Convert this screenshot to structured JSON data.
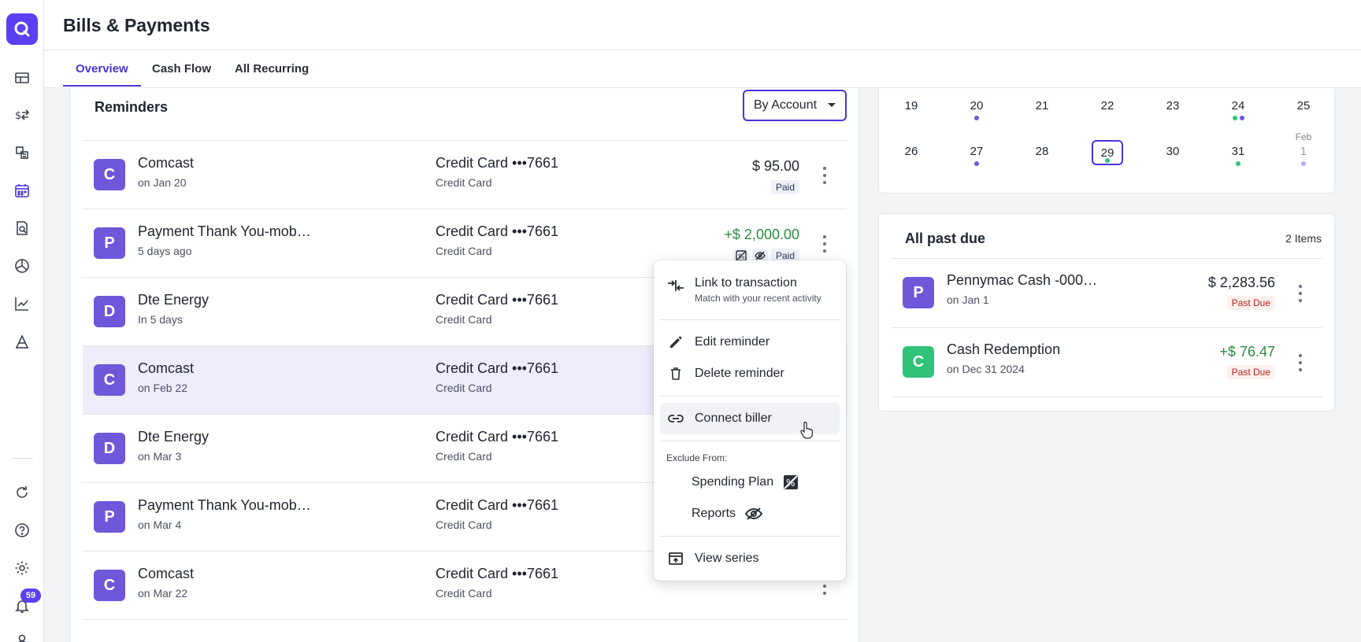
{
  "header": {
    "title": "Bills & Payments",
    "tabs": [
      {
        "label": "Overview",
        "active": true
      },
      {
        "label": "Cash Flow",
        "active": false
      },
      {
        "label": "All Recurring",
        "active": false
      }
    ]
  },
  "rail": {
    "notification_count": "59"
  },
  "reminders": {
    "title": "Reminders",
    "group_by": "By Account",
    "rows": [
      {
        "initial": "C",
        "name": "Comcast",
        "sub": "on Jan 20",
        "account": "Credit Card •••7661",
        "account_type": "Credit Card",
        "amount": "$ 95.00",
        "status": "Paid"
      },
      {
        "initial": "P",
        "name": "Payment Thank You-mob…",
        "sub": "5 days ago",
        "account": "Credit Card •••7661",
        "account_type": "Credit Card",
        "amount": "+$ 2,000.00",
        "status": "Paid"
      },
      {
        "initial": "D",
        "name": "Dte Energy",
        "sub": "In 5 days",
        "account": "Credit Card •••7661",
        "account_type": "Credit Card"
      },
      {
        "initial": "C",
        "name": "Comcast",
        "sub": "on Feb 22",
        "account": "Credit Card •••7661",
        "account_type": "Credit Card"
      },
      {
        "initial": "D",
        "name": "Dte Energy",
        "sub": "on Mar 3",
        "account": "Credit Card •••7661",
        "account_type": "Credit Card"
      },
      {
        "initial": "P",
        "name": "Payment Thank You-mob…",
        "sub": "on Mar 4",
        "account": "Credit Card •••7661",
        "account_type": "Credit Card"
      },
      {
        "initial": "C",
        "name": "Comcast",
        "sub": "on Mar 22",
        "account": "Credit Card •••7661",
        "account_type": "Credit Card"
      }
    ]
  },
  "calendar": {
    "week1": [
      "19",
      "20",
      "21",
      "22",
      "23",
      "24",
      "25"
    ],
    "week2": [
      "26",
      "27",
      "28",
      "29",
      "30",
      "31",
      "1"
    ],
    "next_month_label": "Feb",
    "selected_day": "29",
    "colors": {
      "purple": "#6e57d9",
      "green": "#2fc279",
      "light_purple": "#b8aef0"
    }
  },
  "past_due": {
    "title": "All past due",
    "count": "2 Items",
    "rows": [
      {
        "initial": "P",
        "name": "Pennymac Cash -000…",
        "sub": "on Jan 1",
        "amount": "$ 2,283.56",
        "status": "Past Due"
      },
      {
        "initial": "C",
        "name": "Cash Redemption",
        "sub": "on Dec 31 2024",
        "amount": "+$ 76.47",
        "status": "Past Due"
      }
    ]
  },
  "menu": {
    "link_transaction": "Link to transaction",
    "link_transaction_sub": "Match with your recent activity",
    "edit": "Edit reminder",
    "delete": "Delete reminder",
    "connect": "Connect biller",
    "exclude_label": "Exclude From:",
    "spending_plan": "Spending Plan",
    "reports": "Reports",
    "view_series": "View series"
  },
  "colors": {
    "accent": "#4a33d9",
    "brand": "#5b3ff2",
    "positive": "#2b8a3e",
    "negative": "#b3261e"
  }
}
